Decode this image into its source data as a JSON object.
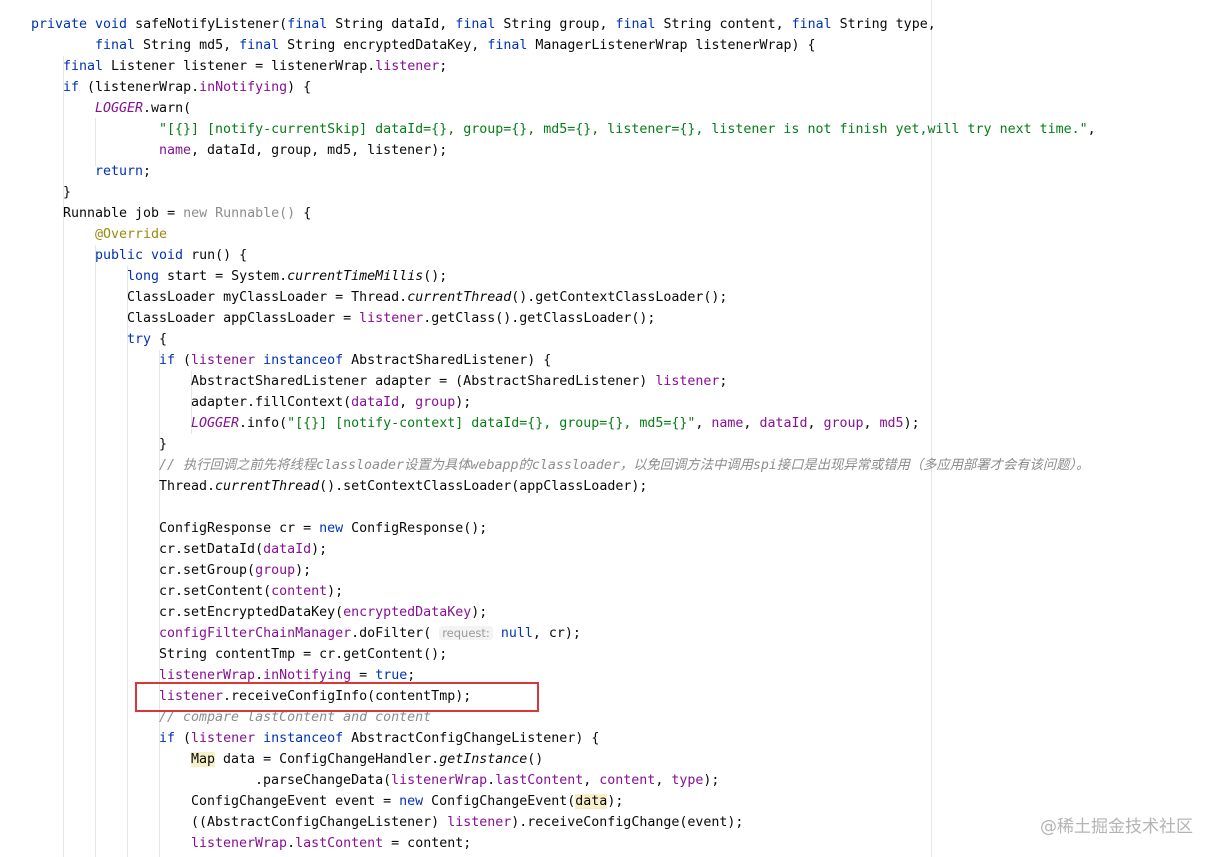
{
  "editor": {
    "lines": [
      "private void safeNotifyListener(final String dataId, final String group, final String content, final String type,",
      "final String md5, final String encryptedDataKey, final ManagerListenerWrap listenerWrap) {",
      "final Listener listener = listenerWrap.listener;",
      "if (listenerWrap.inNotifying) {",
      "LOGGER.warn(",
      "\"[{}] [notify-currentSkip] dataId={}, group={}, md5={}, listener={}, listener is not finish yet,will try next time.\",",
      "name, dataId, group, md5, listener);",
      "return;",
      "}",
      "Runnable job = new Runnable() {",
      "@Override",
      "public void run() {",
      "long start = System.currentTimeMillis();",
      "ClassLoader myClassLoader = Thread.currentThread().getContextClassLoader();",
      "ClassLoader appClassLoader = listener.getClass().getClassLoader();",
      "try {",
      "if (listener instanceof AbstractSharedListener) {",
      "AbstractSharedListener adapter = (AbstractSharedListener) listener;",
      "adapter.fillContext(dataId, group);",
      "LOGGER.info(\"[{}] [notify-context] dataId={}, group={}, md5={}\", name, dataId, group, md5);",
      "}",
      "// 执行回调之前先将线程classloader设置为具体webapp的classloader，以免回调方法中调用spi接口是出现异常或错用（多应用部署才会有该问题）。",
      "Thread.currentThread().setContextClassLoader(appClassLoader);",
      "",
      "ConfigResponse cr = new ConfigResponse();",
      "cr.setDataId(dataId);",
      "cr.setGroup(group);",
      "cr.setContent(content);",
      "cr.setEncryptedDataKey(encryptedDataKey);",
      "configFilterChainManager.doFilter( request: null, cr);",
      "String contentTmp = cr.getContent();",
      "listenerWrap.inNotifying = true;",
      "listener.receiveConfigInfo(contentTmp);",
      "// compare lastContent and content",
      "if (listener instanceof AbstractConfigChangeListener) {",
      "Map data = ConfigChangeHandler.getInstance()",
      ".parseChangeData(listenerWrap.lastContent, content, type);",
      "ConfigChangeEvent event = new ConfigChangeEvent(data);",
      "((AbstractConfigChangeListener) listener).receiveConfigChange(event);",
      "listenerWrap.lastContent = content;"
    ],
    "highlighted_line": "listener.receiveConfigInfo(contentTmp);",
    "param_hint": "request:",
    "highlight_color": "#d9383a"
  },
  "watermark": "@稀土掘金技术社区"
}
